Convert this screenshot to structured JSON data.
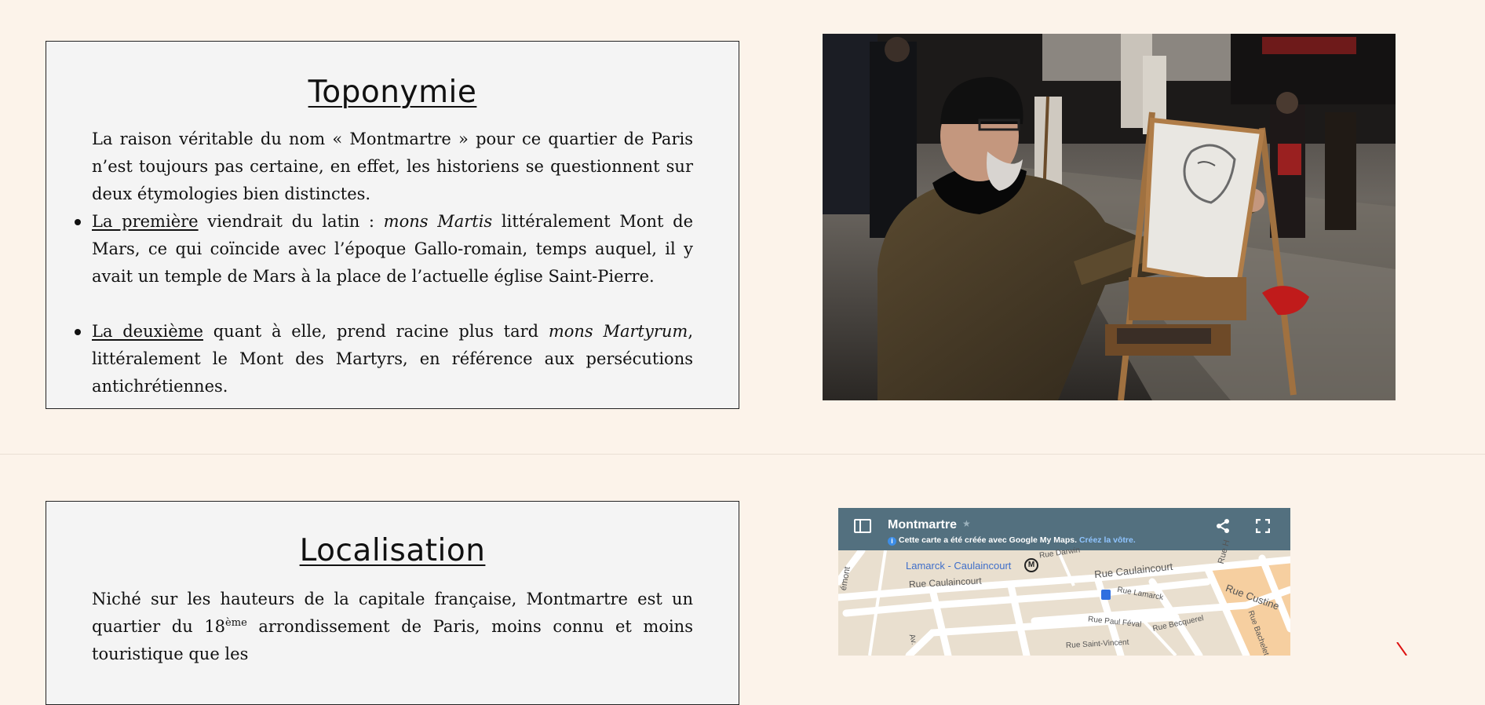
{
  "toponymie": {
    "title": "Toponymie",
    "intro": "La raison véritable du nom « Montmartre » pour ce quartier de Paris n’est toujours pas certaine, en effet, les historiens se questionnent sur deux étymologies bien distinctes.",
    "point1": {
      "label": "La première",
      "text_a": " viendrait du latin : ",
      "term": "mons Martis",
      "text_b": " littéralement Mont de Mars, ce qui coïncide avec l’époque Gallo-romain, temps auquel, il y avait un temple de Mars à la place de l’actuelle église Saint-Pierre."
    },
    "point2": {
      "label": "La deuxième",
      "text_a": " quant à elle, prend racine plus tard ",
      "term": "mons Martyrum",
      "text_b": ", littéralement le Mont des Martyrs, en référence aux persécutions antichrétiennes."
    }
  },
  "photo": {
    "subject": "painter-at-easel"
  },
  "localisation": {
    "title": "Localisation",
    "text_a": "Niché sur les hauteurs de la capitale française, Montmartre est un quartier du 18",
    "sup": "ème",
    "text_b": " arrondissement de Paris, moins connu et moins touristique que les"
  },
  "map": {
    "title": "Montmartre",
    "note": "Cette carte a été créée avec Google My Maps.",
    "note_link": "Créez la vôtre.",
    "station": "Lamarck - Caulaincourt",
    "streets": [
      "Rue Caulaincourt",
      "Rue Caulaincourt",
      "Rue Lamarck",
      "Rue Custine",
      "Rue Paul Féval",
      "Rue Becquerel",
      "Rue Saint-Vincent",
      "Rue Darwin",
      "Rue H",
      "Rue Bachelet",
      "émont",
      "Av."
    ]
  },
  "colors": {
    "page_bg": "#fcf3ea",
    "card_bg": "#f4f4f4",
    "map_header": "#53707f",
    "link": "#8fc4ff",
    "station_label": "#3f6ec9"
  }
}
